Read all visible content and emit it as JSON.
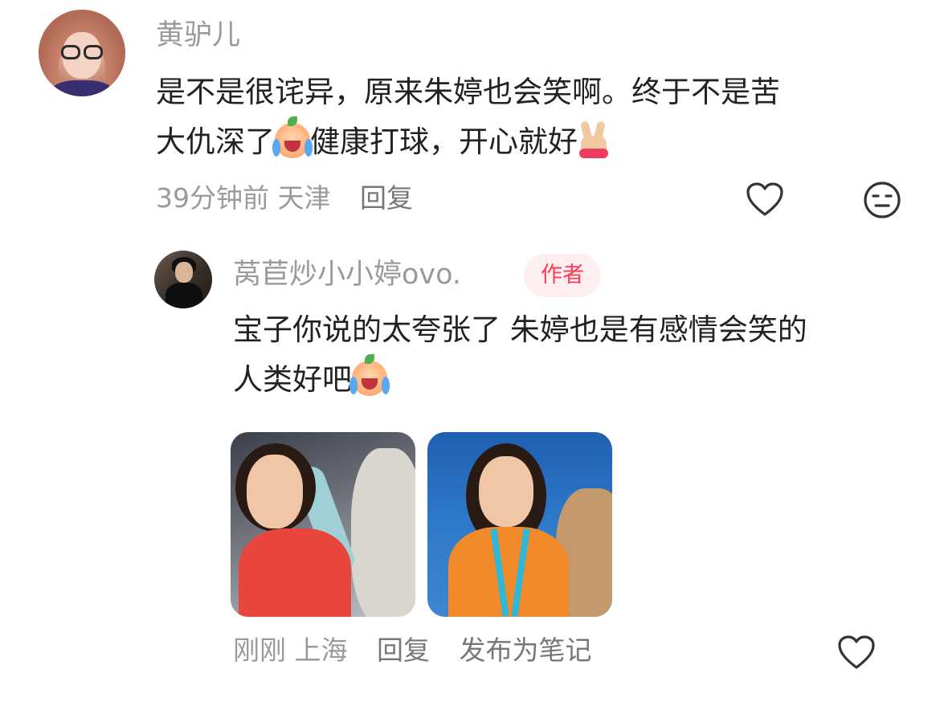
{
  "comment": {
    "username": "黄驴儿",
    "text_lines": [
      "是不是很诧异，原来朱婷也会笑啊。终于不是苦",
      "大仇深了",
      "健康打球，开心就好"
    ],
    "emojis": [
      "crying-emoji",
      "peace-hand-emoji"
    ],
    "time": "39分钟前",
    "location": "天津",
    "reply_label": "回复"
  },
  "reply": {
    "username": "莴苣炒小小婷ovo.",
    "badge": "作者",
    "text_lines": [
      "宝子你说的太夸张了 朱婷也是有感情会笑的",
      "人类好吧"
    ],
    "emojis": [
      "crying-emoji"
    ],
    "time": "刚刚",
    "location": "上海",
    "reply_label": "回复",
    "publish_label": "发布为笔记"
  },
  "icons": {
    "like": "heart-outline-icon",
    "dislike": "neutral-face-icon"
  },
  "colors": {
    "secondary_text": "#9a9a9a",
    "primary_text": "#222222",
    "badge_text": "#fa3c55",
    "badge_bg": "#fdeef0"
  }
}
